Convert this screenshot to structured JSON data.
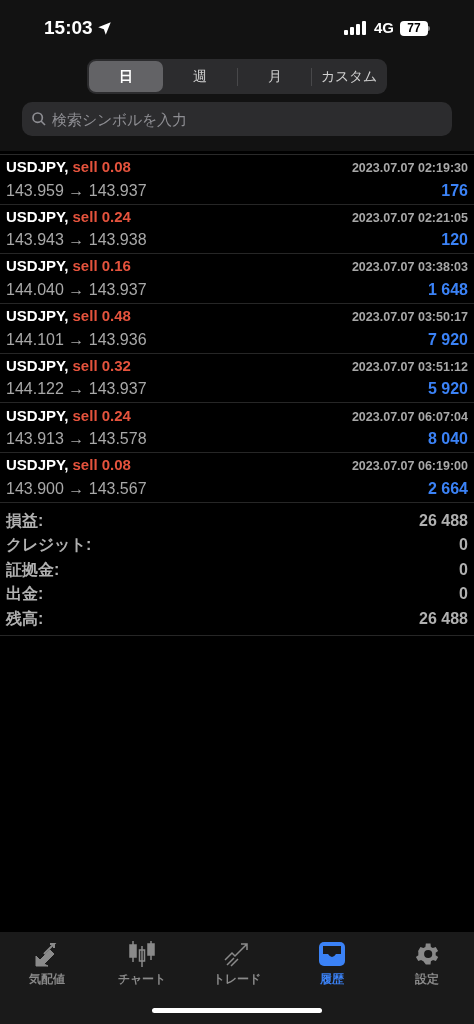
{
  "status_bar": {
    "time": "15:03",
    "network": "4G",
    "battery": "77"
  },
  "period_tabs": [
    {
      "label": "日",
      "selected": true
    },
    {
      "label": "週",
      "selected": false
    },
    {
      "label": "月",
      "selected": false
    },
    {
      "label": "カスタム",
      "selected": false
    }
  ],
  "search": {
    "placeholder": "検索シンボルを入力"
  },
  "deals": [
    {
      "symbol": "USDJPY,",
      "kind": "sell",
      "side": "sell 0.08",
      "time": "2023.07.07 02:19:30",
      "prices": "143.959 → 143.937",
      "profit": "176"
    },
    {
      "symbol": "USDJPY,",
      "kind": "sell",
      "side": "sell 0.24",
      "time": "2023.07.07 02:21:05",
      "prices": "143.943 → 143.938",
      "profit": "120"
    },
    {
      "symbol": "USDJPY,",
      "kind": "sell",
      "side": "sell 0.16",
      "time": "2023.07.07 03:38:03",
      "prices": "144.040 → 143.937",
      "profit": "1 648"
    },
    {
      "symbol": "USDJPY,",
      "kind": "sell",
      "side": "sell 0.48",
      "time": "2023.07.07 03:50:17",
      "prices": "144.101 → 143.936",
      "profit": "7 920"
    },
    {
      "symbol": "USDJPY,",
      "kind": "sell",
      "side": "sell 0.32",
      "time": "2023.07.07 03:51:12",
      "prices": "144.122 → 143.937",
      "profit": "5 920"
    },
    {
      "symbol": "USDJPY,",
      "kind": "sell",
      "side": "sell 0.24",
      "time": "2023.07.07 06:07:04",
      "prices": "143.913 → 143.578",
      "profit": "8 040"
    },
    {
      "symbol": "USDJPY,",
      "kind": "sell",
      "side": "sell 0.08",
      "time": "2023.07.07 06:19:00",
      "prices": "143.900 → 143.567",
      "profit": "2 664"
    }
  ],
  "summary": [
    {
      "label": "損益:",
      "value": "26 488"
    },
    {
      "label": "クレジット:",
      "value": "0"
    },
    {
      "label": "証拠金:",
      "value": "0"
    },
    {
      "label": "出金:",
      "value": "0"
    },
    {
      "label": "残高:",
      "value": "26 488"
    }
  ],
  "tab_bar": [
    {
      "kind": "quotes",
      "label": "気配値",
      "selected": false
    },
    {
      "kind": "chart",
      "label": "チャート",
      "selected": false
    },
    {
      "kind": "trade",
      "label": "トレード",
      "selected": false
    },
    {
      "kind": "history",
      "label": "履歴",
      "selected": true
    },
    {
      "kind": "settings",
      "label": "設定",
      "selected": false
    }
  ]
}
